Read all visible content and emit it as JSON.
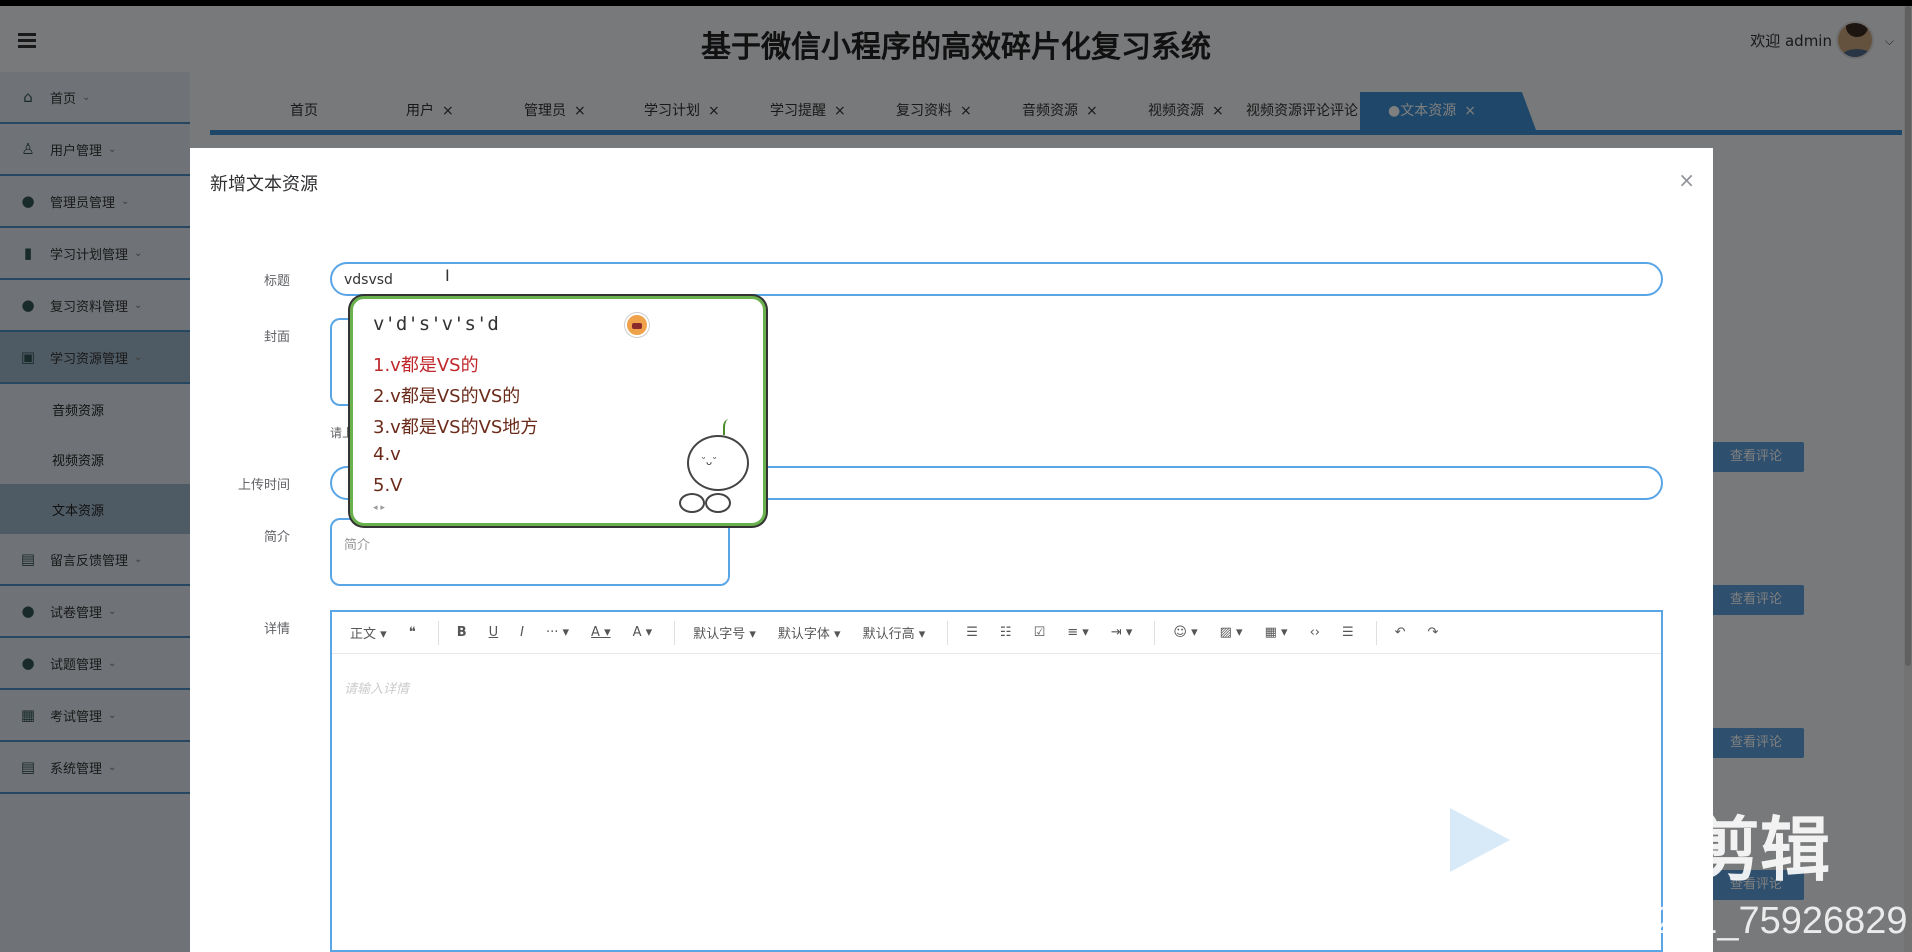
{
  "app": {
    "title": "基于微信小程序的高效碎片化复习系统",
    "welcome": "欢迎 admin"
  },
  "sidebar": {
    "items": [
      {
        "label": "首页",
        "icon": "home-icon",
        "glyph": "⌂"
      },
      {
        "label": "用户管理",
        "icon": "user-icon",
        "glyph": "♙"
      },
      {
        "label": "管理员管理",
        "icon": "admin-icon",
        "glyph": "●"
      },
      {
        "label": "学习计划管理",
        "icon": "plan-icon",
        "glyph": "▮"
      },
      {
        "label": "复习资料管理",
        "icon": "material-icon",
        "glyph": "●"
      },
      {
        "label": "学习资源管理",
        "icon": "resource-icon",
        "glyph": "▣"
      }
    ],
    "subitems": [
      "音频资源",
      "视频资源",
      "文本资源"
    ],
    "more_items": [
      {
        "label": "留言反馈管理",
        "icon": "feedback-icon",
        "glyph": "▤"
      },
      {
        "label": "试卷管理",
        "icon": "paper-icon",
        "glyph": "●"
      },
      {
        "label": "试题管理",
        "icon": "question-icon",
        "glyph": "●"
      },
      {
        "label": "考试管理",
        "icon": "exam-icon",
        "glyph": "▦"
      },
      {
        "label": "系统管理",
        "icon": "system-icon",
        "glyph": "▤"
      }
    ]
  },
  "tabs": [
    "首页",
    "用户",
    "管理员",
    "学习计划",
    "学习提醒",
    "复习资料",
    "音频资源",
    "视频资源",
    "视频资源评论评论",
    "●文本资源"
  ],
  "bg_buttons": [
    "查看评论",
    "查看评论",
    "查看评论",
    "查看评论"
  ],
  "modal": {
    "title": "新增文本资源",
    "close": "×",
    "labels": {
      "title": "标题",
      "cover": "封面",
      "upload_time": "上传时间",
      "intro": "简介",
      "details": "详情"
    },
    "title_value": "vdsvsd",
    "cover_hint": "请上",
    "intro_placeholder": "简介",
    "details_placeholder": "请输入详情",
    "toolbar": [
      "正文",
      "❝",
      "B",
      "U",
      "I",
      "···",
      "A",
      "A",
      "默认字号",
      "默认字体",
      "默认行高",
      "☰",
      "☷",
      "☑",
      "≡",
      "⇥",
      "☺",
      "▨",
      "▦",
      "‹›",
      "☰",
      "↶",
      "↷"
    ]
  },
  "ime": {
    "composition": "v'd's'v's'd",
    "candidates": [
      "1.v都是VS的",
      "2.v都是VS的VS的",
      "3.v都是VS的VS地方",
      "4.v",
      "5.V"
    ],
    "nav": "◂ ▸"
  },
  "watermark": {
    "text": "CSDN @2201_75926829",
    "brand": "剪辑"
  }
}
